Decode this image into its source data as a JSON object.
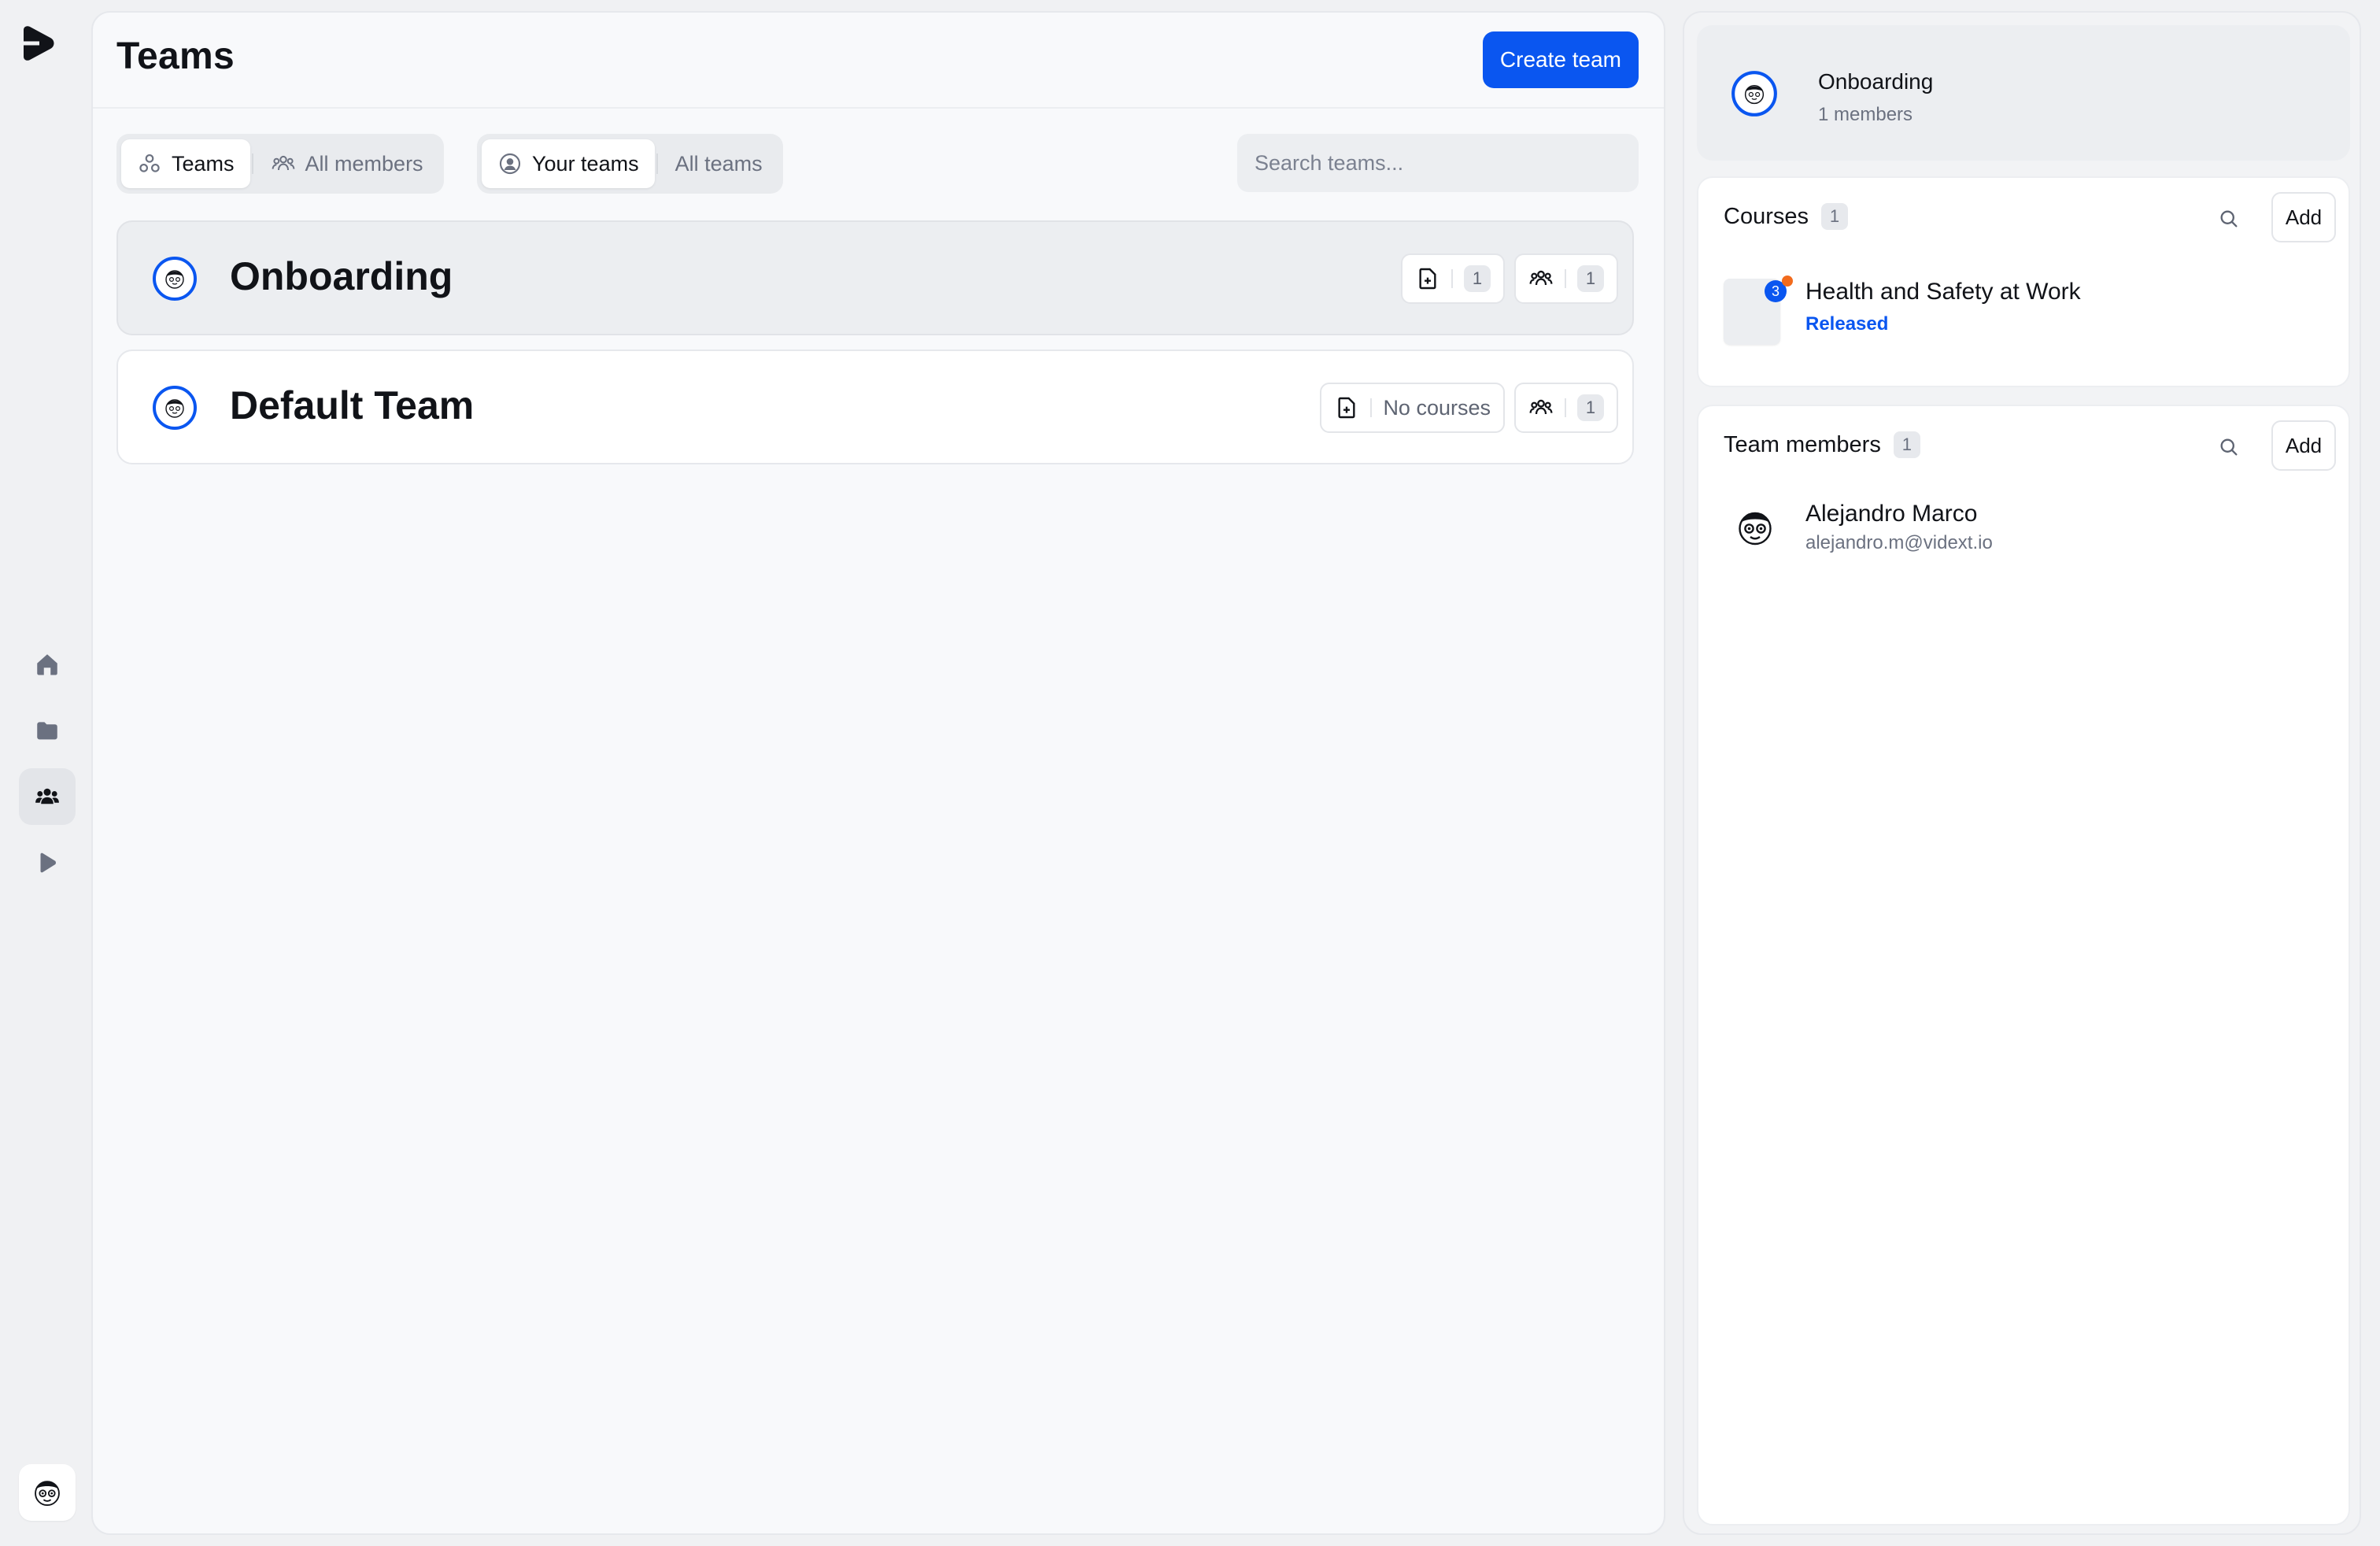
{
  "header": {
    "title": "Teams",
    "create_label": "Create team"
  },
  "view_tabs": [
    {
      "label": "Teams",
      "icon": "teams-icon",
      "active": true
    },
    {
      "label": "All members",
      "icon": "members-icon",
      "active": false
    }
  ],
  "scope_tabs": [
    {
      "label": "Your teams",
      "icon": "user-circle-icon",
      "active": true
    },
    {
      "label": "All teams",
      "active": false
    }
  ],
  "search": {
    "placeholder": "Search teams..."
  },
  "teams": [
    {
      "name": "Onboarding",
      "courses": "1",
      "members": "1",
      "selected": true
    },
    {
      "name": "Default Team",
      "courses": "No courses",
      "members": "1",
      "selected": false
    }
  ],
  "nav": [
    "home-icon",
    "folder-icon",
    "team-nav-icon",
    "play-icon"
  ],
  "detail": {
    "name": "Onboarding",
    "subtitle": "1 members",
    "courses": {
      "title": "Courses",
      "count": "1",
      "add_label": "Add",
      "items": [
        {
          "name": "Health and Safety at Work",
          "status": "Released",
          "badge": "3"
        }
      ]
    },
    "members": {
      "title": "Team members",
      "count": "1",
      "add_label": "Add",
      "items": [
        {
          "name": "Alejandro Marco",
          "email": "alejandro.m@vidext.io"
        }
      ]
    }
  },
  "colors": {
    "accent": "#0a56f0",
    "notification": "#f26b1d"
  }
}
